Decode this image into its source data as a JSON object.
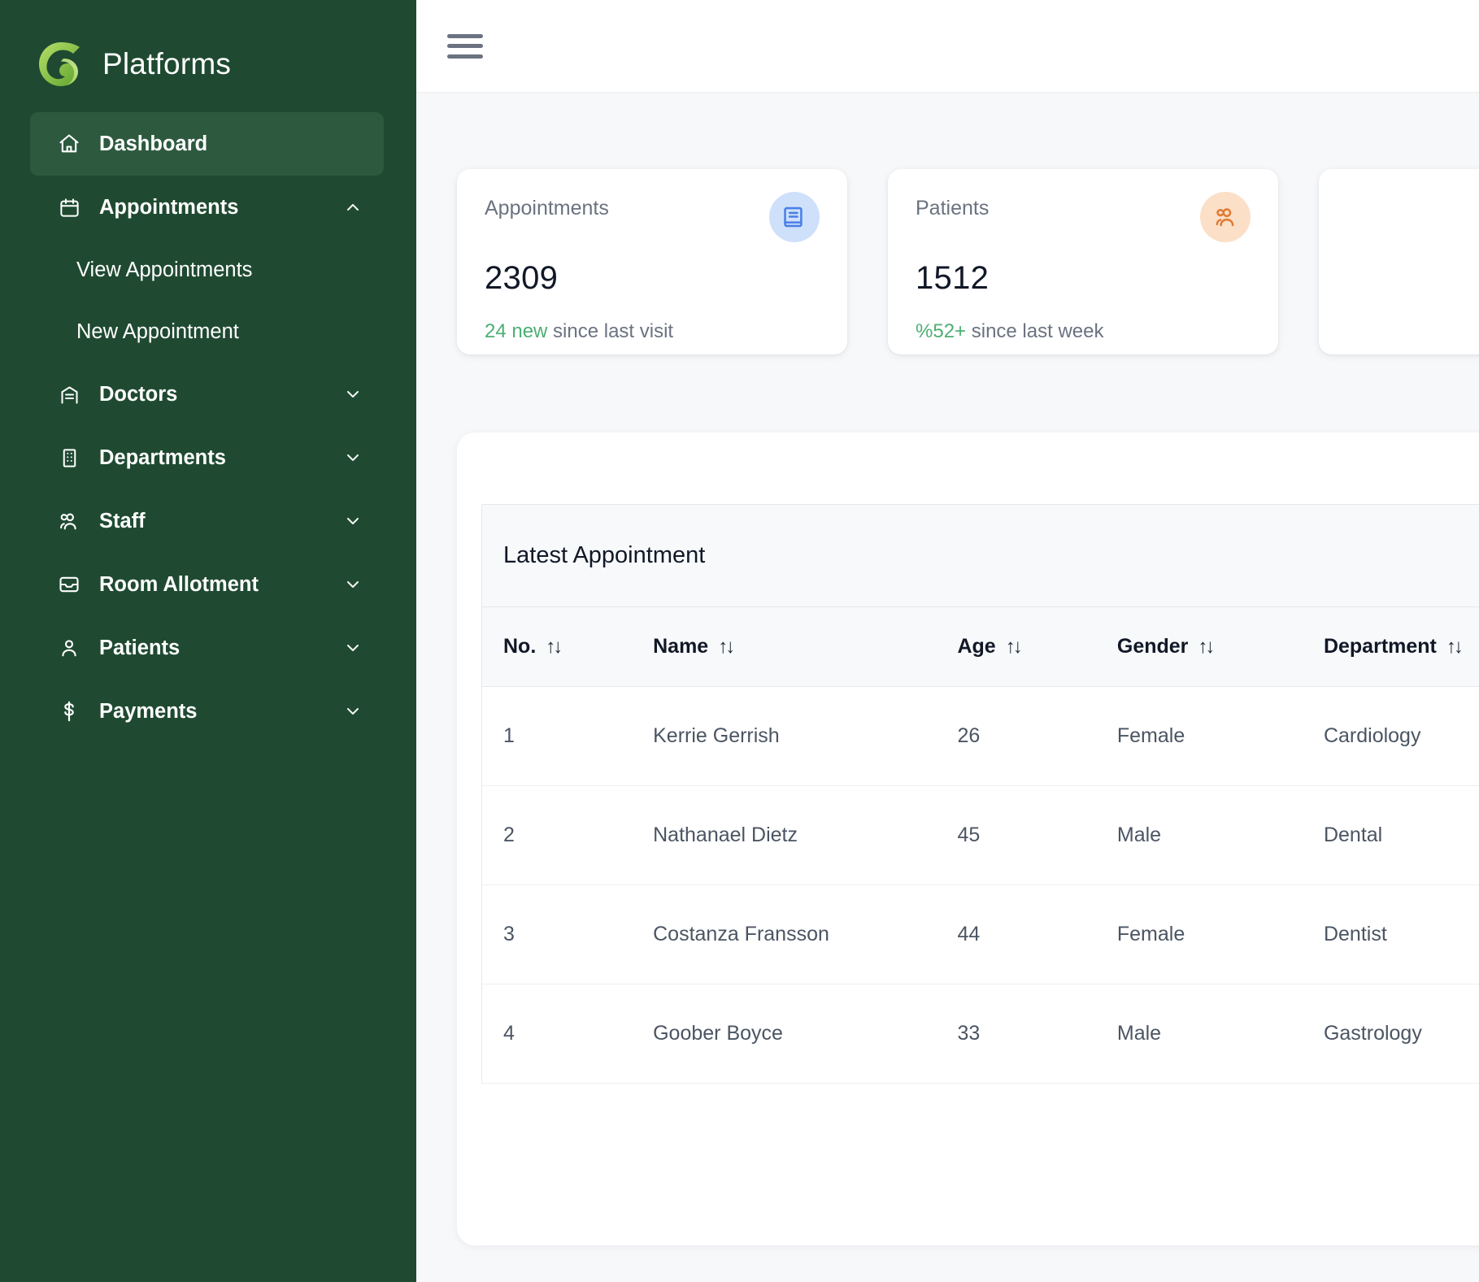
{
  "brand": {
    "title": "Platforms",
    "logo_icon": "spiral-g-logo",
    "accent": "#7CB342"
  },
  "sidebar": {
    "background": "#1F4A31",
    "active_background": "#2D5A3F",
    "items": [
      {
        "label": "Dashboard",
        "icon": "home-icon",
        "active": true,
        "expandable": false
      },
      {
        "label": "Appointments",
        "icon": "calendar-icon",
        "active": false,
        "expandable": true,
        "expanded": true,
        "chevron": "chevron-up-icon"
      },
      {
        "label": "Doctors",
        "icon": "clinic-building-icon",
        "active": false,
        "expandable": true,
        "expanded": false,
        "chevron": "chevron-down-icon"
      },
      {
        "label": "Departments",
        "icon": "office-building-icon",
        "active": false,
        "expandable": true,
        "expanded": false,
        "chevron": "chevron-down-icon"
      },
      {
        "label": "Staff",
        "icon": "users-icon",
        "active": false,
        "expandable": true,
        "expanded": false,
        "chevron": "chevron-down-icon"
      },
      {
        "label": "Room Allotment",
        "icon": "inbox-icon",
        "active": false,
        "expandable": true,
        "expanded": false,
        "chevron": "chevron-down-icon"
      },
      {
        "label": "Patients",
        "icon": "user-icon",
        "active": false,
        "expandable": true,
        "expanded": false,
        "chevron": "chevron-down-icon"
      },
      {
        "label": "Payments",
        "icon": "dollar-icon",
        "active": false,
        "expandable": true,
        "expanded": false,
        "chevron": "chevron-down-icon"
      }
    ],
    "appointments_submenu": [
      {
        "label": "View Appointments"
      },
      {
        "label": "New Appointment"
      }
    ]
  },
  "topbar": {
    "menu_toggle_icon": "hamburger-icon"
  },
  "stat_cards": [
    {
      "title": "Appointments",
      "value": "2309",
      "delta": "24 new",
      "delta_suffix": " since last visit",
      "delta_color": "#4CAF72",
      "icon": "book-icon",
      "icon_bg": "#CFE0FB",
      "icon_color": "#4A7FE8"
    },
    {
      "title": "Patients",
      "value": "1512",
      "delta": "%52+",
      "delta_suffix": " since last week",
      "delta_color": "#4CAF72",
      "icon": "users-icon",
      "icon_bg": "#FBDFC7",
      "icon_color": "#E07A33"
    }
  ],
  "table": {
    "caption": "Latest Appointment",
    "sort_glyph": "↑↓",
    "columns": [
      "No.",
      "Name",
      "Age",
      "Gender",
      "Department"
    ],
    "rows": [
      {
        "no": "1",
        "name": "Kerrie Gerrish",
        "age": "26",
        "gender": "Female",
        "department": "Cardiology"
      },
      {
        "no": "2",
        "name": "Nathanael Dietz",
        "age": "45",
        "gender": "Male",
        "department": "Dental"
      },
      {
        "no": "3",
        "name": "Costanza Fransson",
        "age": "44",
        "gender": "Female",
        "department": "Dentist"
      },
      {
        "no": "4",
        "name": "Goober Boyce",
        "age": "33",
        "gender": "Male",
        "department": "Gastrology"
      }
    ]
  }
}
